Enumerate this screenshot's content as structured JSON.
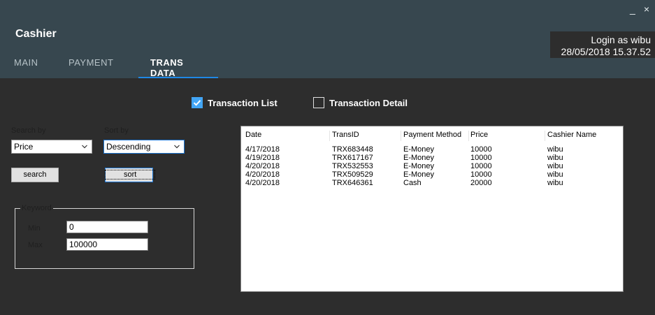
{
  "window": {
    "minimize_label": "_",
    "close_label": "×"
  },
  "header": {
    "title": "Cashier",
    "tabs": [
      {
        "label": "MAIN"
      },
      {
        "label": "PAYMENT"
      },
      {
        "label": "TRANS DATA"
      }
    ],
    "active_tab": "TRANS DATA",
    "login_text": "Login as wibu",
    "datetime": "28/05/2018 15.37.52",
    "accent_color": "#1e88e5",
    "background_color": "#37474f"
  },
  "view_toggle": {
    "transaction_list": {
      "label": "Transaction List",
      "checked": true
    },
    "transaction_detail": {
      "label": "Transaction Detail",
      "checked": false
    }
  },
  "search": {
    "search_by_label": "Search by",
    "search_by_value": "Price",
    "sort_by_label": "Sort by",
    "sort_by_value": "Descending",
    "search_button": "search",
    "sort_button": "sort"
  },
  "keyword": {
    "legend": "Keyword",
    "min_label": "Min",
    "min_value": "0",
    "max_label": "Max",
    "max_value": "100000"
  },
  "table": {
    "columns": [
      "Date",
      "TransID",
      "Payment Method",
      "Price",
      "Cashier Name"
    ],
    "rows": [
      [
        "4/17/2018",
        "TRX683448",
        "E-Money",
        "10000",
        "wibu"
      ],
      [
        "4/19/2018",
        "TRX617167",
        "E-Money",
        "10000",
        "wibu"
      ],
      [
        "4/20/2018",
        "TRX532553",
        "E-Money",
        "10000",
        "wibu"
      ],
      [
        "4/20/2018",
        "TRX509529",
        "E-Money",
        "10000",
        "wibu"
      ],
      [
        "4/20/2018",
        "TRX646361",
        "Cash",
        "20000",
        "wibu"
      ]
    ]
  }
}
